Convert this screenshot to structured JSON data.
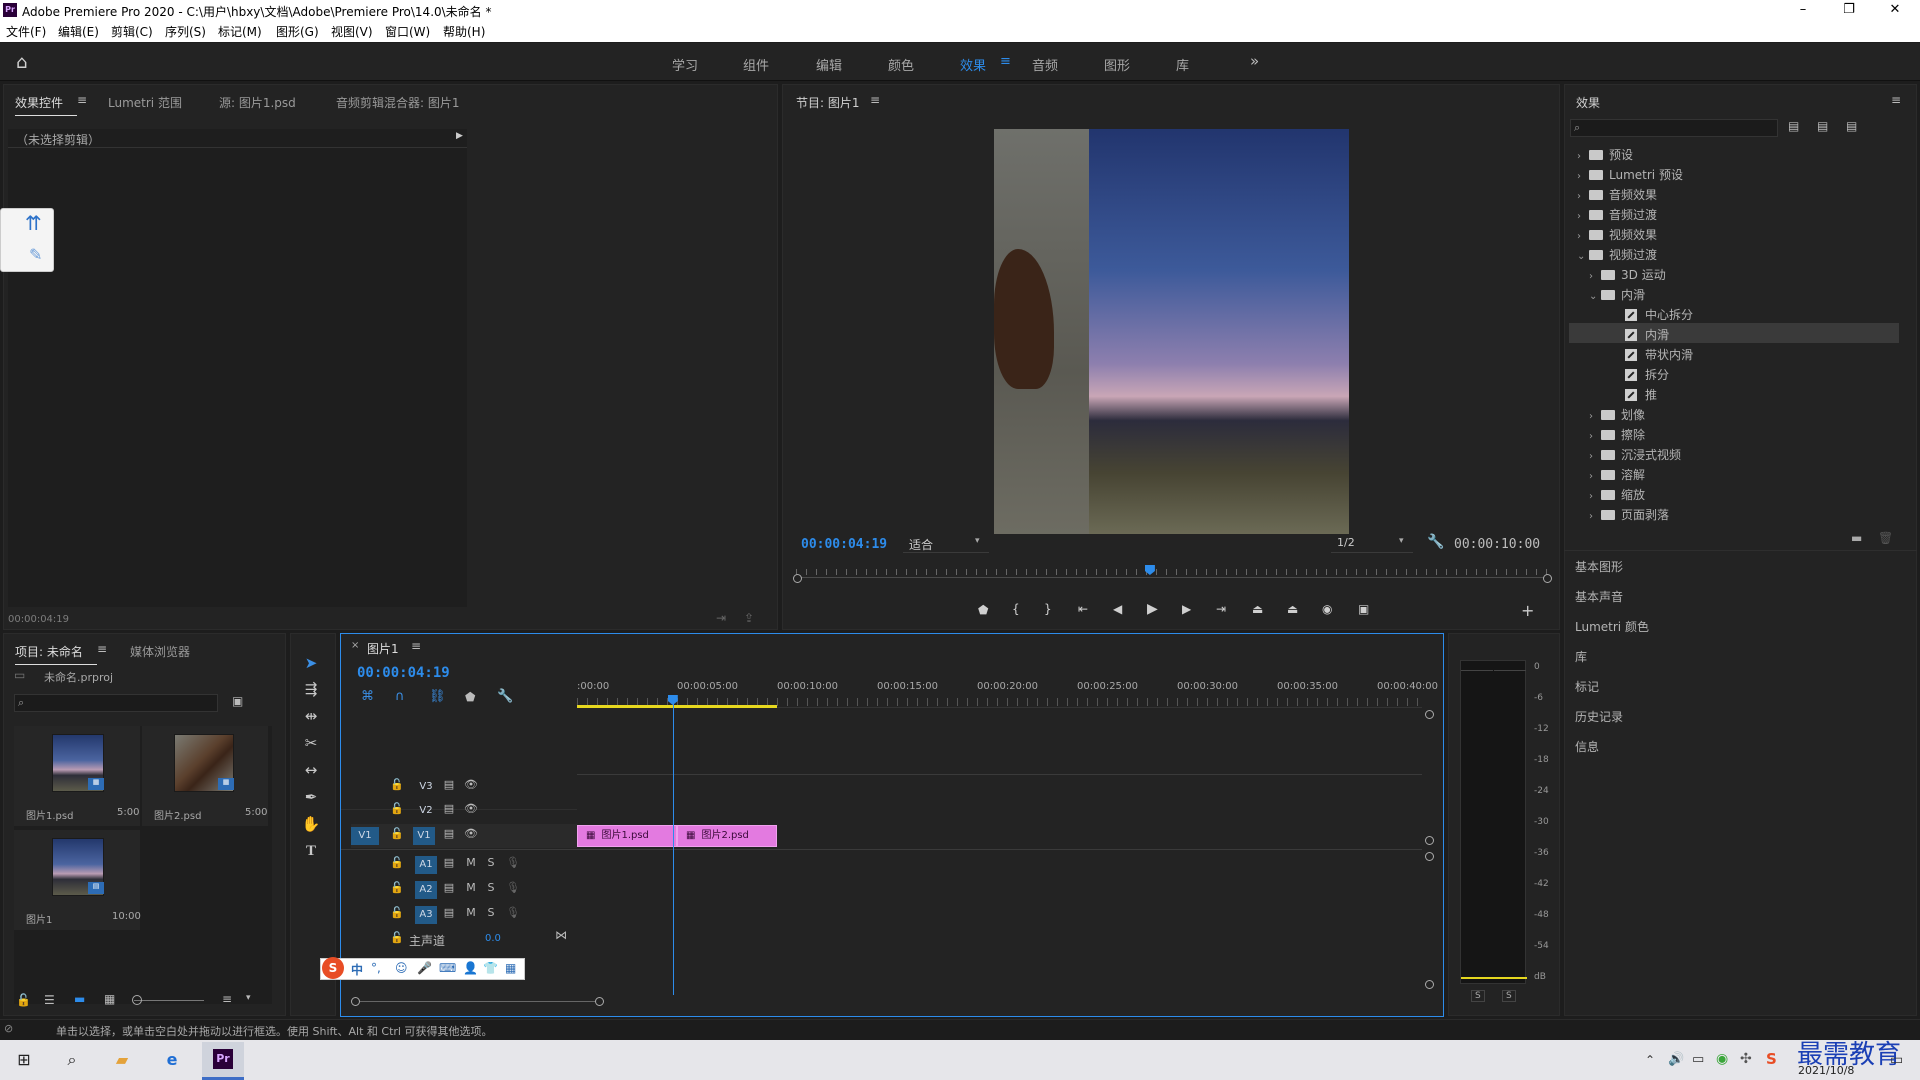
{
  "window": {
    "title": "Adobe Premiere Pro 2020 - C:\\用户\\hbxy\\文档\\Adobe\\Premiere Pro\\14.0\\未命名 *",
    "app_icon": "Pr",
    "minimize": "–",
    "restore": "❐",
    "close": "✕"
  },
  "menu": [
    "文件(F)",
    "编辑(E)",
    "剪辑(C)",
    "序列(S)",
    "标记(M)",
    "图形(G)",
    "视图(V)",
    "窗口(W)",
    "帮助(H)"
  ],
  "workspaces": [
    "学习",
    "组件",
    "编辑",
    "颜色",
    "效果",
    "音频",
    "图形",
    "库"
  ],
  "active_workspace": "效果",
  "effect_controls": {
    "tabs": [
      "效果控件",
      "Lumetri 范围",
      "源: 图片1.psd",
      "音频剪辑混合器: 图片1"
    ],
    "no_clip": "（未选择剪辑）",
    "timecode": "00:00:04:19"
  },
  "program": {
    "tab": "节目: 图片1",
    "timecode": "00:00:04:19",
    "fit": "适合",
    "resolution": "1/2",
    "duration": "00:00:10:00",
    "playhead_fraction": 0.47
  },
  "effects_panel": {
    "title": "效果",
    "tree": [
      {
        "label": "预设",
        "level": 0,
        "type": "folder-special",
        "open": false
      },
      {
        "label": "Lumetri 预设",
        "level": 0,
        "type": "folder-special",
        "open": false
      },
      {
        "label": "音频效果",
        "level": 0,
        "type": "folder",
        "open": false
      },
      {
        "label": "音频过渡",
        "level": 0,
        "type": "folder",
        "open": false
      },
      {
        "label": "视频效果",
        "level": 0,
        "type": "folder",
        "open": false
      },
      {
        "label": "视频过渡",
        "level": 0,
        "type": "folder",
        "open": true
      },
      {
        "label": "3D 运动",
        "level": 1,
        "type": "folder",
        "open": false
      },
      {
        "label": "内滑",
        "level": 1,
        "type": "folder",
        "open": true
      },
      {
        "label": "中心拆分",
        "level": 2,
        "type": "effect"
      },
      {
        "label": "内滑",
        "level": 2,
        "type": "effect",
        "selected": true
      },
      {
        "label": "带状内滑",
        "level": 2,
        "type": "effect"
      },
      {
        "label": "拆分",
        "level": 2,
        "type": "effect"
      },
      {
        "label": "推",
        "level": 2,
        "type": "effect"
      },
      {
        "label": "划像",
        "level": 1,
        "type": "folder",
        "open": false
      },
      {
        "label": "擦除",
        "level": 1,
        "type": "folder",
        "open": false
      },
      {
        "label": "沉浸式视频",
        "level": 1,
        "type": "folder",
        "open": false
      },
      {
        "label": "溶解",
        "level": 1,
        "type": "folder",
        "open": false
      },
      {
        "label": "缩放",
        "level": 1,
        "type": "folder",
        "open": false
      },
      {
        "label": "页面剥落",
        "level": 1,
        "type": "folder",
        "open": false
      }
    ],
    "side_panels": [
      "基本图形",
      "基本声音",
      "Lumetri 颜色",
      "库",
      "标记",
      "历史记录",
      "信息"
    ]
  },
  "project": {
    "tabs": [
      "项目: 未命名",
      "媒体浏览器"
    ],
    "file": "未命名.prproj",
    "items": [
      {
        "name": "图片1.psd",
        "duration": "5:00"
      },
      {
        "name": "图片2.psd",
        "duration": "5:00"
      },
      {
        "name": "图片1",
        "duration": "10:00"
      }
    ]
  },
  "timeline": {
    "tab": "图片1",
    "timecode": "00:00:04:19",
    "ruler": [
      ":00:00",
      "00:00:05:00",
      "00:00:10:00",
      "00:00:15:00",
      "00:00:20:00",
      "00:00:25:00",
      "00:00:30:00",
      "00:00:35:00",
      "00:00:40:00"
    ],
    "video_tracks": [
      "V3",
      "V2",
      "V1"
    ],
    "audio_tracks": [
      "A1",
      "A2",
      "A3"
    ],
    "source_patch": "V1",
    "master": {
      "label": "主声道",
      "value": "0.0"
    },
    "clips": [
      {
        "name": "图片1.psd",
        "start": 0,
        "end": 5
      },
      {
        "name": "图片2.psd",
        "start": 5,
        "end": 10
      }
    ],
    "playhead_seconds": 4.79,
    "track_letters": {
      "mute": "M",
      "solo": "S"
    }
  },
  "meter": {
    "labels": [
      "0",
      "-6",
      "-12",
      "-18",
      "-24",
      "-30",
      "-36",
      "-42",
      "-48",
      "-54",
      "dB"
    ],
    "solo": [
      "S",
      "S"
    ]
  },
  "status": "单击以选择，或单击空白处并拖动以进行框选。使用 Shift、Alt 和 Ctrl 可获得其他选项。",
  "taskbar": {
    "date": "2021/10/8",
    "watermark": "最需教育"
  },
  "colors": {
    "accent": "#2d8ceb",
    "clip": "#e37ae0",
    "track_on": "#225a88"
  }
}
